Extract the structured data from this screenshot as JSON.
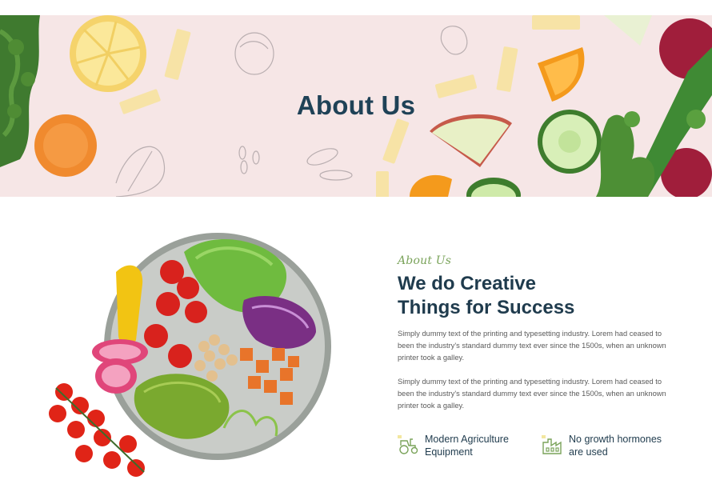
{
  "hero": {
    "title": "About Us"
  },
  "about": {
    "eyebrow": "About Us",
    "heading_line1": "We do Creative",
    "heading_line2": "Things for Success",
    "paragraph1": "Simply dummy text of the printing and typesetting industry. Lorem had ceased to been the industry's standard dummy text ever since the 1500s, when an unknown printer took a galley.",
    "paragraph2": "Simply dummy text of the printing and typesetting industry. Lorem had ceased to been the industry's standard dummy text ever since the 1500s, when an unknown printer took a galley."
  },
  "features": [
    {
      "icon": "tractor-icon",
      "label": "Modern Agriculture Equipment"
    },
    {
      "icon": "factory-icon",
      "label": "No growth hormones are used"
    }
  ],
  "colors": {
    "heading": "#1f3b4d",
    "accent_green": "#7aa35a",
    "hero_bg": "#f6e6e6",
    "body_text": "#5a5a5a"
  }
}
